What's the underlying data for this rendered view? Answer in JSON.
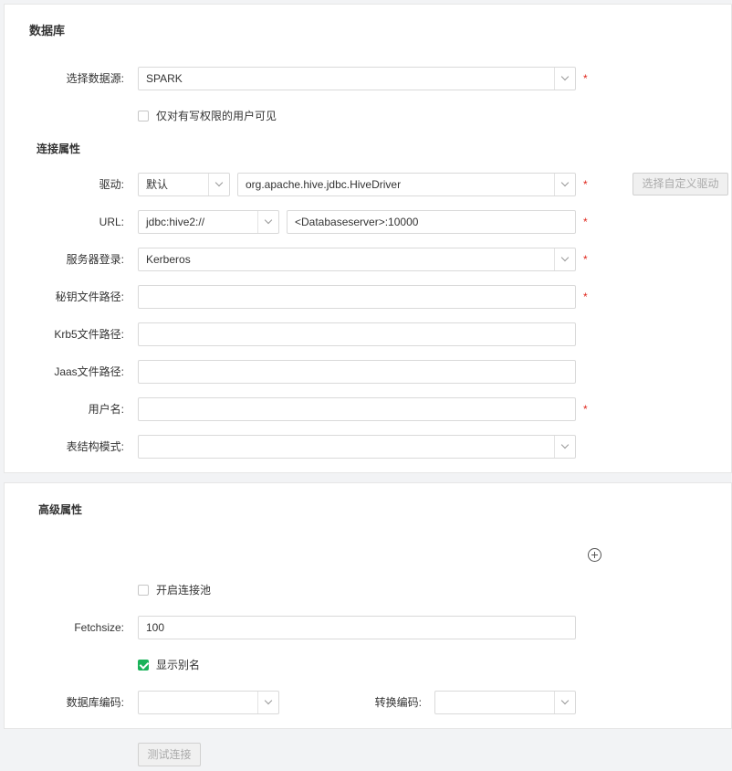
{
  "database_section": {
    "title": "数据库",
    "datasource_label": "选择数据源:",
    "datasource_value": "SPARK",
    "write_only_label": "仅对有写权限的用户可见",
    "write_only_checked": false
  },
  "connection": {
    "title": "连接属性",
    "driver_label": "驱动:",
    "driver_mode": "默认",
    "driver_class": "org.apache.hive.jdbc.HiveDriver",
    "custom_driver_button": "选择自定义驱动",
    "url_label": "URL:",
    "url_prefix": "jdbc:hive2://",
    "url_value": "<Databaseserver>:10000",
    "server_login_label": "服务器登录:",
    "server_login_value": "Kerberos",
    "keytab_label": "秘钥文件路径:",
    "keytab_value": "",
    "krb5_label": "Krb5文件路径:",
    "krb5_value": "",
    "jaas_label": "Jaas文件路径:",
    "jaas_value": "",
    "username_label": "用户名:",
    "username_value": "",
    "schema_label": "表结构模式:",
    "schema_value": "",
    "required_mark": "*"
  },
  "advanced": {
    "title": "高级属性",
    "add_icon": "plus-circle-icon",
    "pool_label": "开启连接池",
    "pool_checked": false,
    "fetchsize_label": "Fetchsize:",
    "fetchsize_value": "100",
    "alias_label": "显示别名",
    "alias_checked": true,
    "db_encoding_label": "数据库编码:",
    "db_encoding_value": "",
    "convert_encoding_label": "转换编码:",
    "convert_encoding_value": ""
  },
  "footer": {
    "test_button": "测试连接"
  },
  "colors": {
    "required": "#e0281e",
    "checkbox_checked": "#1bb35a",
    "background": "#f2f3f5"
  }
}
